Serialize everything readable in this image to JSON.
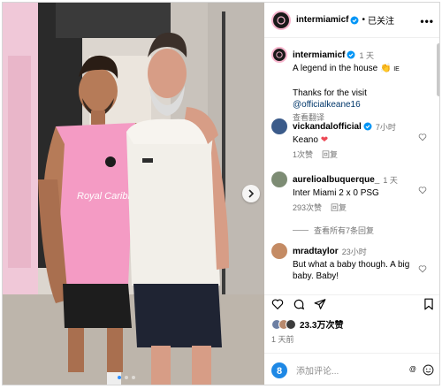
{
  "post": {
    "author": "intermiamicf",
    "follow_sep": "•",
    "follow_label": "已关注",
    "more_label": "•••"
  },
  "caption": {
    "author": "intermiamicf",
    "time": "1 天",
    "line1": "A legend in the house 👏",
    "line1_tag": "IE",
    "line2_prefix": "Thanks for the visit ",
    "line2_mention": "@officialkeane16",
    "translate": "查看翻译"
  },
  "comments": [
    {
      "author": "vickandalofficial",
      "verified": true,
      "time": "7小时",
      "text": "Keano ❤",
      "likes": "1次赞",
      "reply": "回复"
    },
    {
      "author": "aurelioalbuquerque_",
      "verified": false,
      "time": "1 天",
      "text": "Inter Miami 2 x 0 PSG",
      "likes": "293次赞",
      "reply": "回复",
      "view_replies": "查看所有7条回复"
    },
    {
      "author": "mradtaylor",
      "verified": false,
      "time": "23小时",
      "text_line1": "But what a baby though. A big",
      "text_line2": "baby. Baby!",
      "likes": ""
    }
  ],
  "stats": {
    "likes": "23.3万次赞",
    "posted": "1 天前"
  },
  "add_comment": {
    "placeholder": "添加评论...",
    "at_label": "@"
  },
  "photo": {
    "jersey_text": "Royal Caribbean"
  },
  "colors": {
    "brand_pink": "#f7b5cd",
    "link": "#00376b",
    "muted": "#737373",
    "verified": "#0095f6",
    "heart_red": "#ed4956"
  },
  "icons": [
    "ellipsis-icon",
    "verified-icon",
    "heart-icon",
    "comment-icon",
    "share-icon",
    "bookmark-icon",
    "emoji-icon",
    "next-arrow-icon"
  ]
}
